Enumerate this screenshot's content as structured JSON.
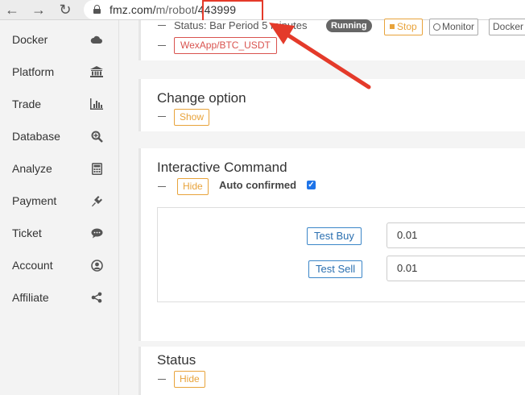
{
  "browser": {
    "url_prefix": "fmz.com/",
    "url_mid": "m",
    "url_sep": "/robot",
    "url_id": "443999"
  },
  "sidebar": {
    "items": [
      {
        "label": "Docker",
        "icon": "cloud-icon"
      },
      {
        "label": "Platform",
        "icon": "bank-icon"
      },
      {
        "label": "Trade",
        "icon": "bar-chart-icon"
      },
      {
        "label": "Database",
        "icon": "search-plus-icon"
      },
      {
        "label": "Analyze",
        "icon": "calculator-icon"
      },
      {
        "label": "Payment",
        "icon": "plug-icon"
      },
      {
        "label": "Ticket",
        "icon": "comment-icon"
      },
      {
        "label": "Account",
        "icon": "user-circle-icon"
      },
      {
        "label": "Affiliate",
        "icon": "share-icon"
      }
    ]
  },
  "robot_panel": {
    "status_text": "Status: Bar Period 5 minutes",
    "status_badge": "Running",
    "stop_label": "Stop",
    "monitor_label": "Monitor",
    "docker_label": "Docker",
    "exchange_tag": "WexApp/BTC_USDT"
  },
  "change_option": {
    "title": "Change option",
    "toggle_label": "Show"
  },
  "interactive": {
    "title": "Interactive Command",
    "toggle_label": "Hide",
    "auto_confirmed_label": "Auto confirmed",
    "auto_confirmed_checked": true,
    "commands": [
      {
        "label": "Test Buy",
        "value": "0.01"
      },
      {
        "label": "Test Sell",
        "value": "0.01"
      }
    ]
  },
  "status_panel": {
    "title": "Status",
    "toggle_label": "Hide"
  },
  "colors": {
    "highlight": "#e43a2a",
    "accent_orange": "#e8a33b",
    "accent_blue": "#3b86c8",
    "tag_red": "#d9534f"
  }
}
